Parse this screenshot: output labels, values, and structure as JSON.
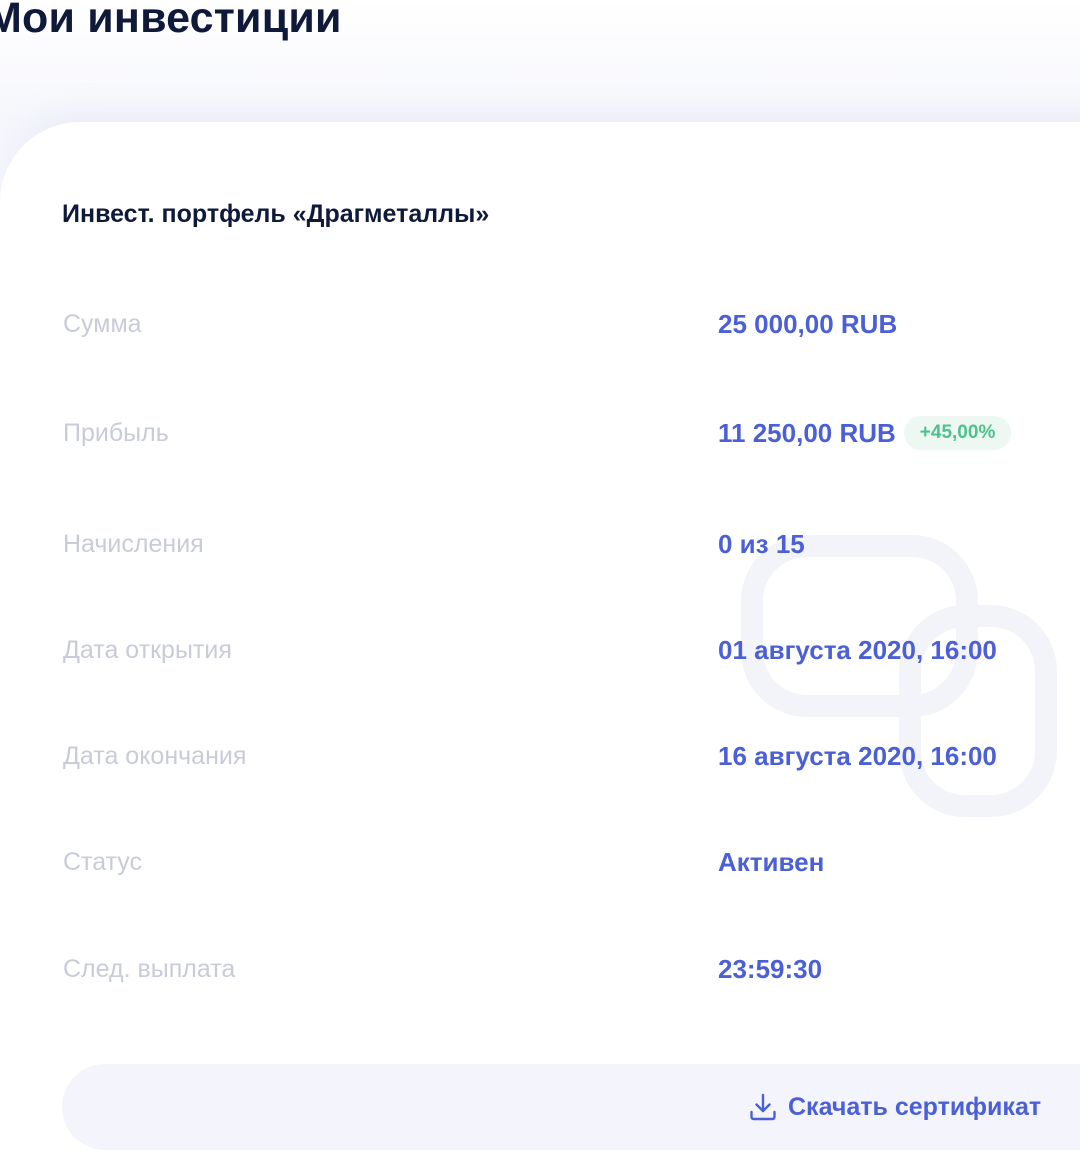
{
  "header": {
    "title": "Мои инвестиции"
  },
  "portfolio": {
    "name": "Инвест. портфель «Драгметаллы»",
    "rows": [
      {
        "label": "Сумма",
        "value": "25 000,00 RUB"
      },
      {
        "label": "Прибыль",
        "value": "11 250,00 RUB",
        "badge": "+45,00%"
      },
      {
        "label": "Начисления",
        "value": "0 из 15"
      },
      {
        "label": "Дата открытия",
        "value": "01 августа 2020, 16:00"
      },
      {
        "label": "Дата окончания",
        "value": "16 августа 2020, 16:00"
      },
      {
        "label": "Статус",
        "value": "Активен"
      },
      {
        "label": "След. выплата",
        "value": "23:59:30"
      }
    ]
  },
  "actions": {
    "download_label": "Скачать сертификат",
    "download_icon": "download-icon"
  },
  "colors": {
    "accent": "#4b5fd6",
    "label": "#c8ccd8",
    "title": "#0f1a3a",
    "badge_bg": "#eef8f3",
    "badge_text": "#4cc28d"
  }
}
